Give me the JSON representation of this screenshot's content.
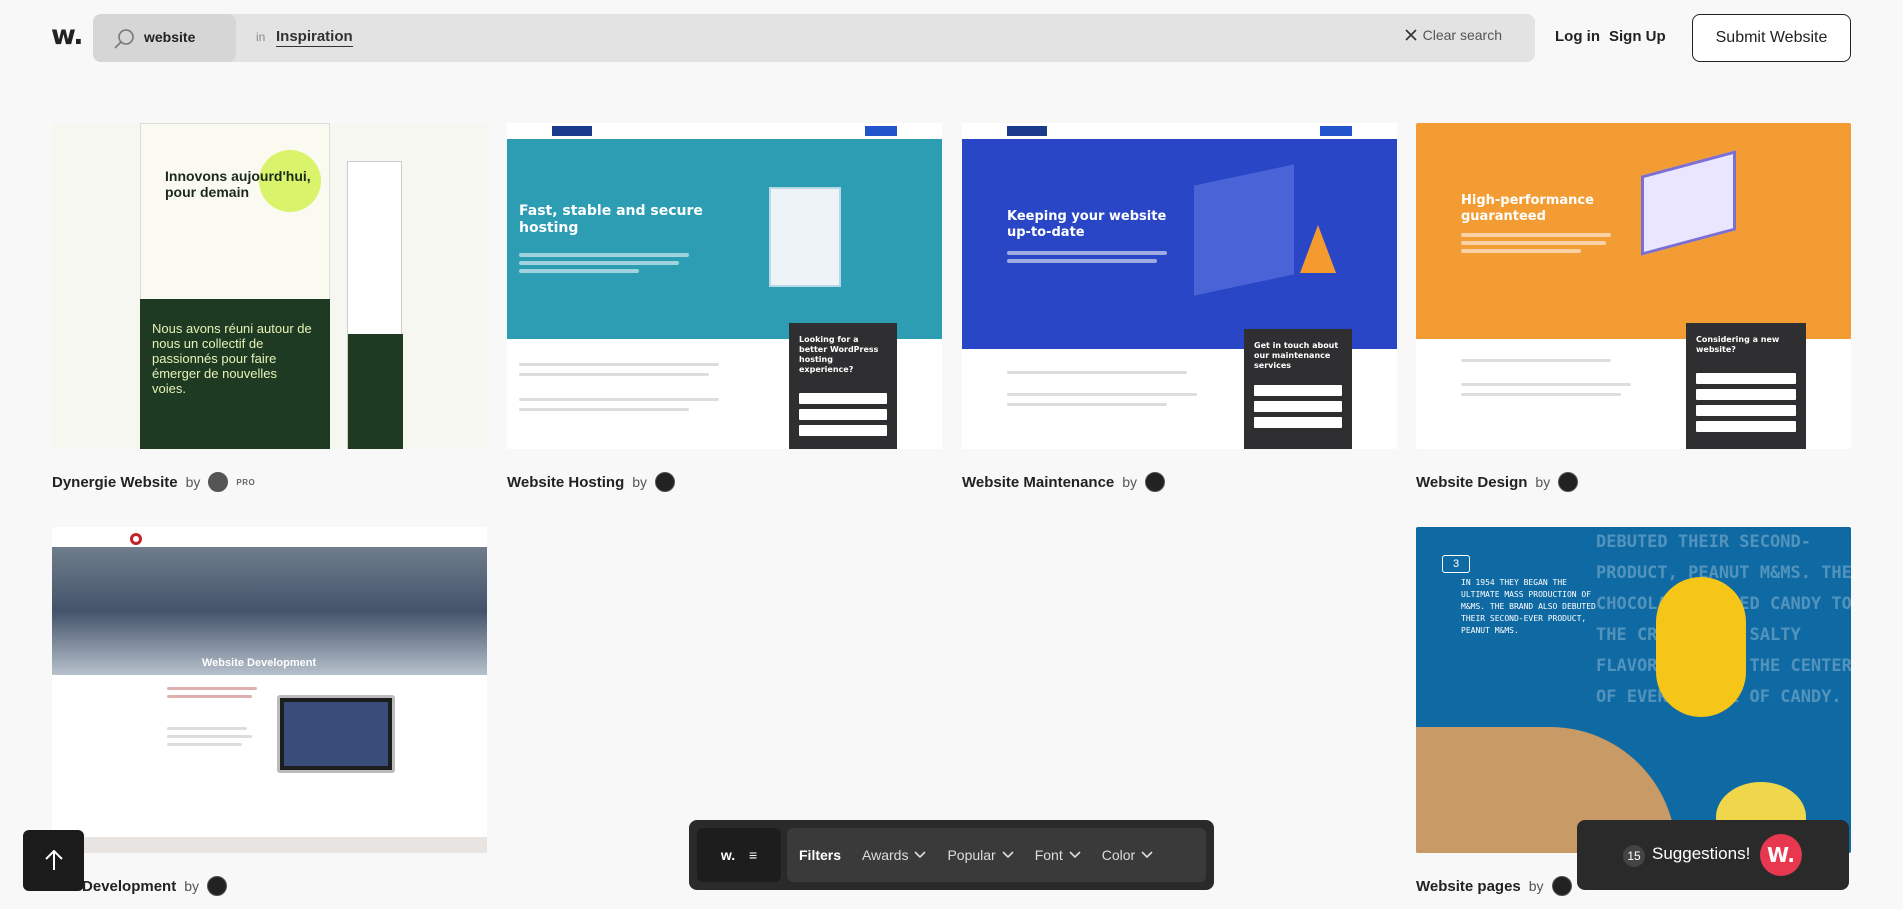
{
  "header": {
    "logo": "w.",
    "search_query": "website",
    "in_label": "in",
    "scope": "Inspiration",
    "clear_search": "Clear search",
    "login": "Log in",
    "signup": "Sign Up",
    "submit": "Submit Website"
  },
  "cards": [
    {
      "title": "Dynergie Website",
      "by": "by",
      "badge": "PRO",
      "hero": "Innovons aujourd'hui, pour demain",
      "dark_text": "Nous avons réuni autour de nous un collectif de passionnés pour faire émerger de nouvelles voies."
    },
    {
      "title": "Website Hosting",
      "by": "by",
      "hero": "Fast, stable and secure hosting",
      "form": "Looking for a better WordPress hosting experience?"
    },
    {
      "title": "Website Maintenance",
      "by": "by",
      "hero": "Keeping your website up-to-date",
      "form": "Get in touch about our maintenance services"
    },
    {
      "title": "Website Design",
      "by": "by",
      "hero": "High-performance guaranteed",
      "form": "Considering a new website?"
    },
    {
      "title": "Website Development",
      "title_visible": "site Development",
      "by": "by",
      "hero": "Website Development"
    },
    {
      "title": "Website pages",
      "by": "by",
      "count": "3",
      "hero": "IN 1954 THEY BEGAN THE ULTIMATE MASS PRODUCTION OF M&MS. THE BRAND ALSO DEBUTED THEIR SECOND-EVER PRODUCT, PEANUT M&MS.",
      "bg_text": "DEBUTED THEIR SECOND-PRODUCT, PEANUT M&MS. THE CHOCOLATE-COATED CANDY TO THE CRUNCH AND SALTY FLAVOR OF A TO THE CENTER OF EVERY PIECE OF CANDY."
    }
  ],
  "filterbar": {
    "logo": "w.",
    "filters": "Filters",
    "awards": "Awards",
    "popular": "Popular",
    "font": "Font",
    "color": "Color"
  },
  "suggestions": {
    "count": "15",
    "label": "Suggestions!",
    "badge": "W."
  },
  "colors": {
    "teal": "#2d9db4",
    "blue": "#2846c5",
    "orange": "#f39c33",
    "dark_green": "#1f3a23",
    "mm_blue": "#0f6aa3",
    "accent_red": "#e8384f"
  }
}
